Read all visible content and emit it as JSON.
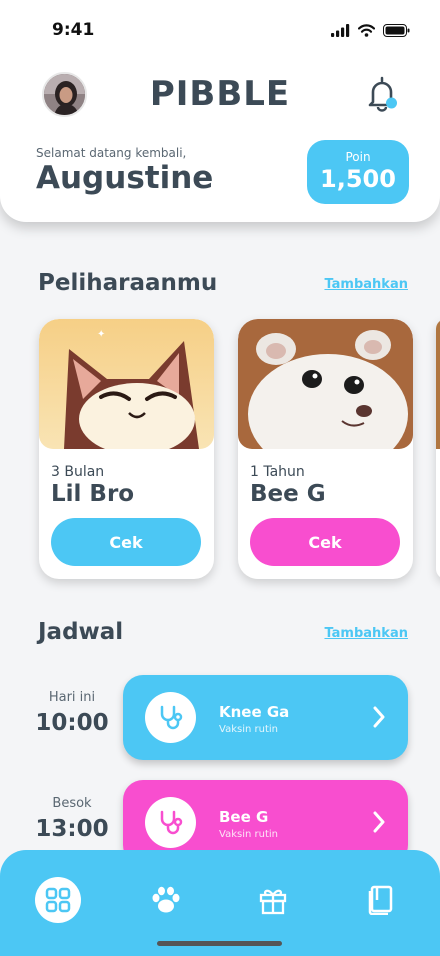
{
  "status_bar": {
    "time": "9:41"
  },
  "header": {
    "app_name": "PIBBLE",
    "welcome": "Selamat datang kembali,",
    "username": "Augustine",
    "points_label": "Poin",
    "points_value": "1,500",
    "notification_icon": "bell-icon"
  },
  "pets": {
    "title": "Peliharaanmu",
    "add_label": "Tambahkan",
    "items": [
      {
        "age": "3 Bulan",
        "name": "Lil Bro",
        "button": "Cek",
        "button_color": "#4cc7f4"
      },
      {
        "age": "1 Tahun",
        "name": "Bee G",
        "button": "Cek",
        "button_color": "#f84ecf"
      }
    ]
  },
  "schedule": {
    "title": "Jadwal",
    "add_label": "Tambahkan",
    "items": [
      {
        "day": "Hari ini",
        "time": "10:00",
        "pet": "Knee Ga",
        "note": "Vaksin rutin",
        "color": "#4cc7f4",
        "icon": "stethoscope-icon"
      },
      {
        "day": "Besok",
        "time": "13:00",
        "pet": "Bee G",
        "note": "Vaksin rutin",
        "color": "#f84ecf",
        "icon": "stethoscope-icon"
      }
    ]
  },
  "bottom_nav": {
    "items": [
      "grid-icon",
      "paw-icon",
      "gift-icon",
      "book-icon"
    ],
    "active": "grid-icon"
  },
  "colors": {
    "accent_blue": "#4cc7f4",
    "accent_pink": "#f84ecf",
    "text": "#3c4a56"
  }
}
